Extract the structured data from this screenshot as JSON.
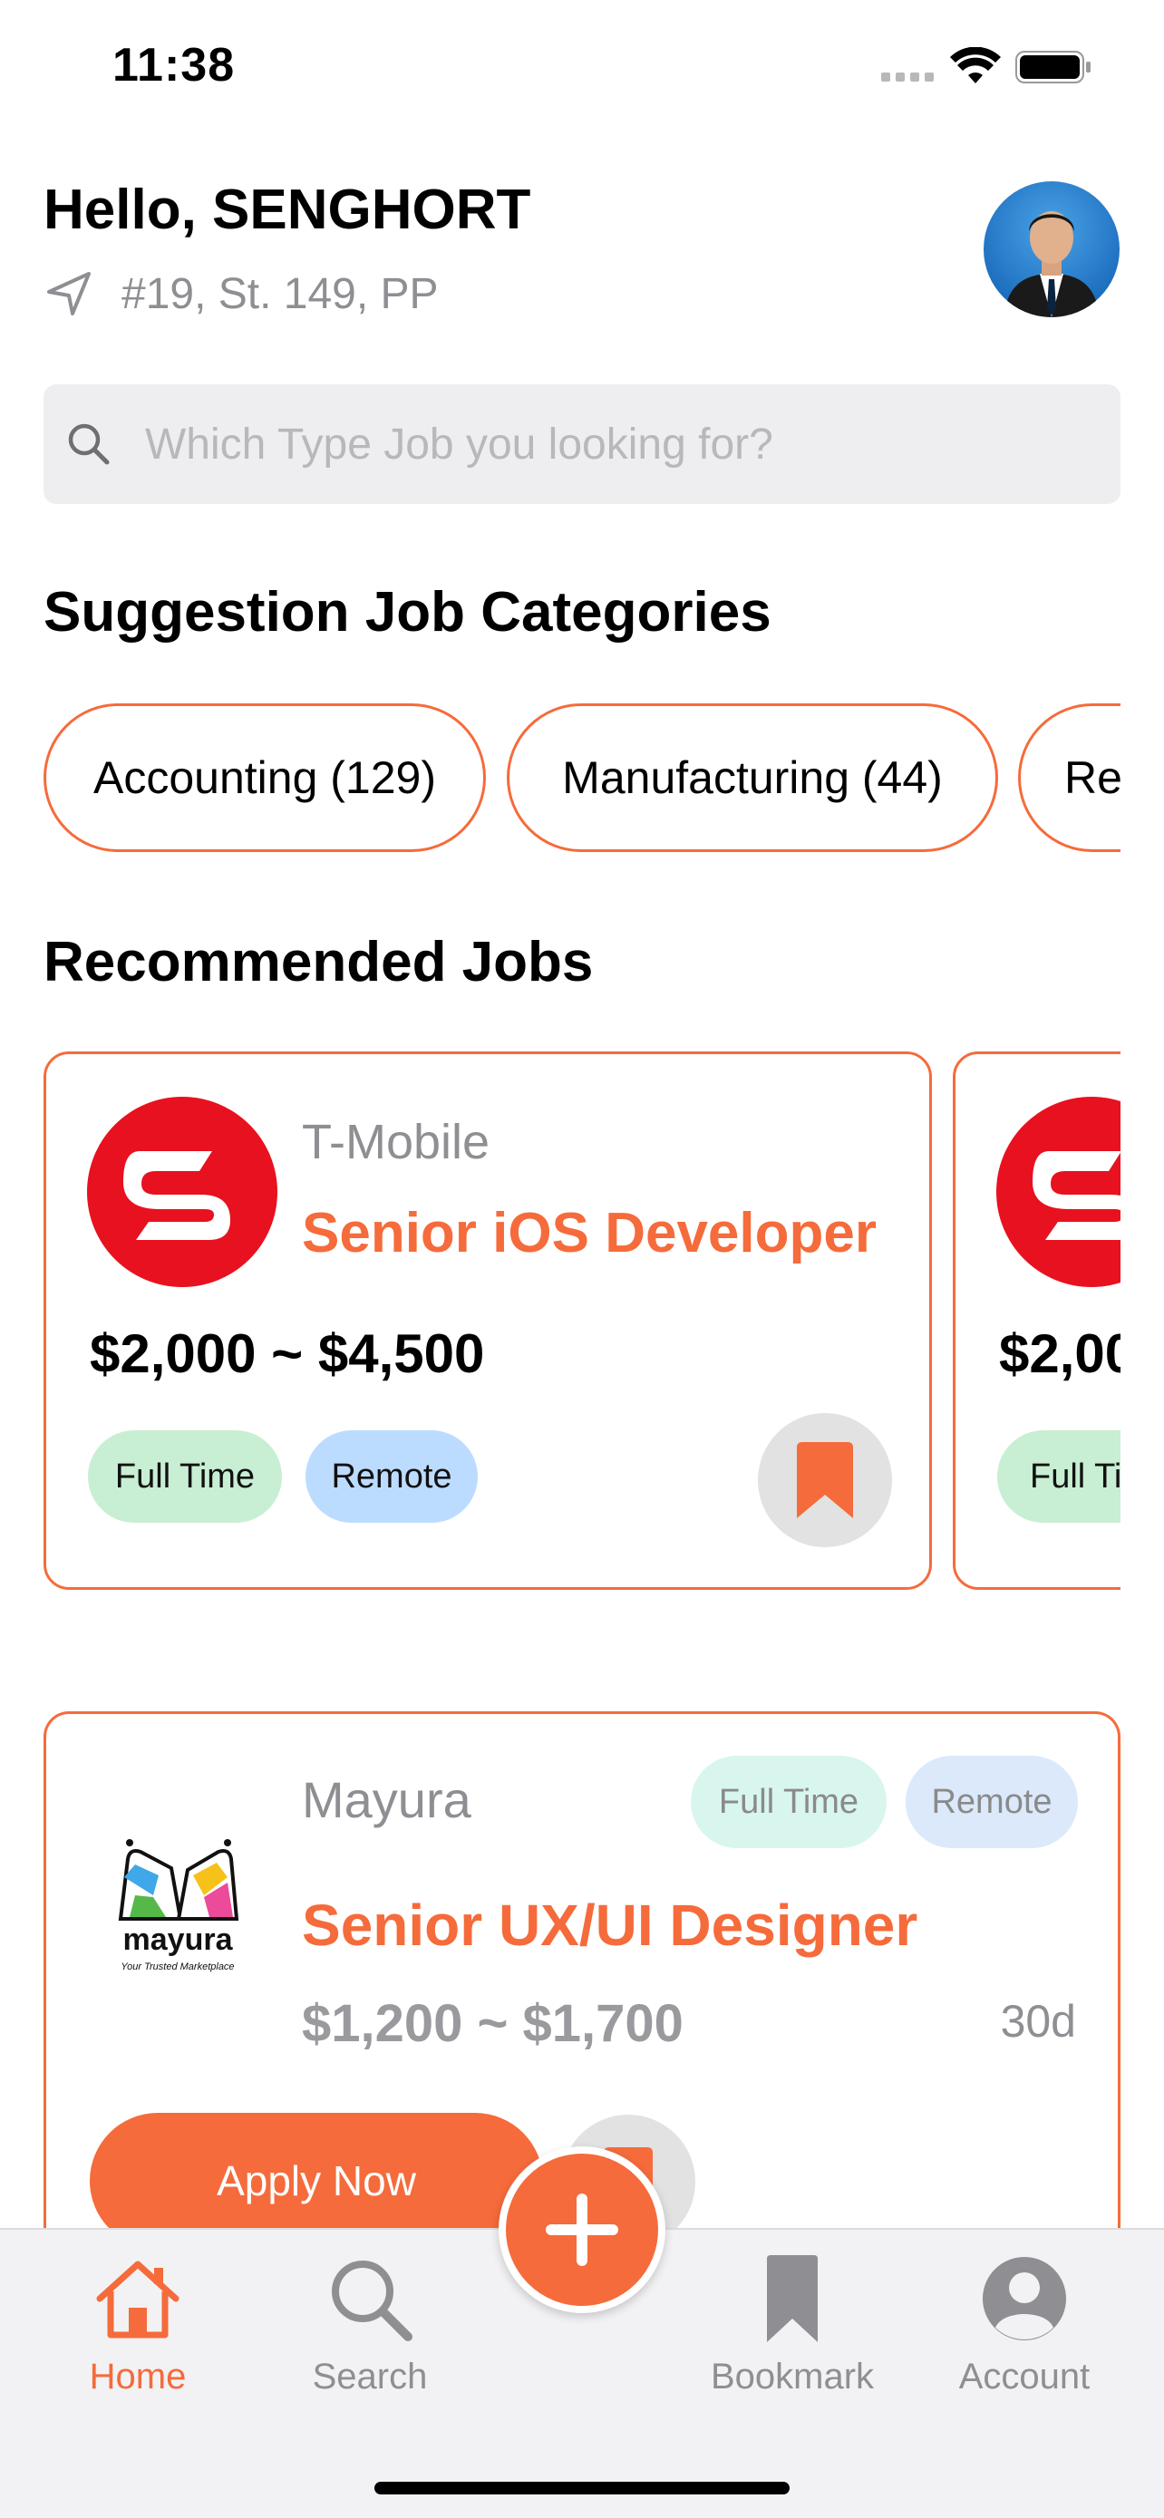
{
  "status_bar": {
    "time": "11:38"
  },
  "header": {
    "greeting": "Hello, SENGHORT",
    "location": "#19, St. 149, PP",
    "avatar_icon": "user-avatar-photo"
  },
  "search": {
    "placeholder": "Which Type Job you looking for?",
    "value": ""
  },
  "categories": {
    "title": "Suggestion Job Categories",
    "items": [
      {
        "label": "Accounting (129)"
      },
      {
        "label": "Manufacturing (44)"
      },
      {
        "label": "Re"
      }
    ]
  },
  "recommended": {
    "title": "Recommended Jobs",
    "cards": [
      {
        "company": "T-Mobile",
        "title": "Senior iOS Developer",
        "salary": "$2,000 ~ $4,500",
        "tags": [
          "Full Time",
          "Remote"
        ],
        "bookmarked": true
      },
      {
        "company": "",
        "title": "",
        "salary": "$2,00",
        "tags": [
          "Full Ti"
        ],
        "bookmarked": false
      }
    ]
  },
  "recent_job": {
    "company": "Mayura",
    "logo_text": "mayura",
    "logo_tagline": "Your Trusted Marketplace",
    "title": "Senior UX/UI Designer",
    "salary": "$1,200 ~ $1,700",
    "age": "30d",
    "tags": [
      "Full Time",
      "Remote"
    ],
    "apply_label": "Apply Now"
  },
  "tab_bar": {
    "items": [
      {
        "label": "Home",
        "icon": "home-icon",
        "active": true
      },
      {
        "label": "Search",
        "icon": "search-icon",
        "active": false
      },
      {
        "label": "Bookmark",
        "icon": "bookmark-icon",
        "active": false
      },
      {
        "label": "Account",
        "icon": "account-icon",
        "active": false
      }
    ],
    "fab_icon": "plus-icon"
  },
  "colors": {
    "accent": "#f56b3b",
    "tag_green": "#c8efd3",
    "tag_blue": "#bcdcff",
    "brand_red": "#e8111f"
  }
}
